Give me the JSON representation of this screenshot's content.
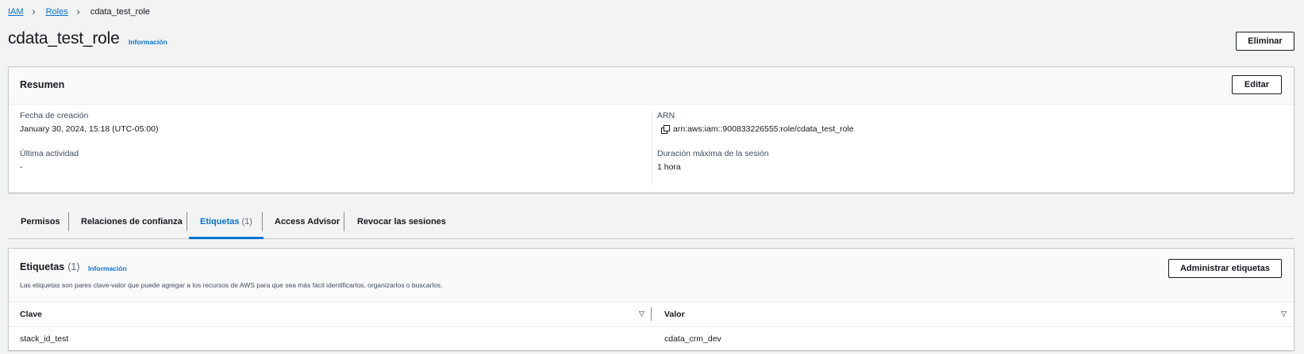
{
  "breadcrumb": {
    "items": [
      "IAM",
      "Roles"
    ],
    "current": "cdata_test_role"
  },
  "header": {
    "title": "cdata_test_role",
    "info_label": "Información",
    "delete_label": "Eliminar"
  },
  "summary": {
    "title": "Resumen",
    "edit_label": "Editar",
    "created_label": "Fecha de creación",
    "created_value": "January 30, 2024, 15:18 (UTC-05:00)",
    "last_activity_label": "Última actividad",
    "last_activity_value": "-",
    "arn_label": "ARN",
    "arn_value": "arn:aws:iam::900833226555:role/cdata_test_role",
    "max_session_label": "Duración máxima de la sesión",
    "max_session_value": "1 hora"
  },
  "tabs": [
    {
      "label": "Permisos",
      "count": ""
    },
    {
      "label": "Relaciones de confianza",
      "count": ""
    },
    {
      "label": "Etiquetas",
      "count": "(1)",
      "active": true
    },
    {
      "label": "Access Advisor",
      "count": ""
    },
    {
      "label": "Revocar las sesiones",
      "count": ""
    }
  ],
  "tags": {
    "title": "Etiquetas",
    "count": "(1)",
    "info_label": "Información",
    "description": "Las etiquetas son pares clave-valor que puede agregar a los recursos de AWS para que sea más fácil identificarlos, organizarlos o buscarlos.",
    "manage_label": "Administrar etiquetas",
    "columns": [
      "Clave",
      "Valor"
    ],
    "rows": [
      {
        "key": "stack_id_test",
        "value": "cdata_crm_dev"
      }
    ]
  },
  "icons": {
    "copy": "copy-icon",
    "sort": "sort-down-icon",
    "breadcrumb_sep": "chevron-right-icon"
  },
  "colors": {
    "link": "#0972d3",
    "background": "#f2f3f3",
    "text": "#16191f"
  }
}
